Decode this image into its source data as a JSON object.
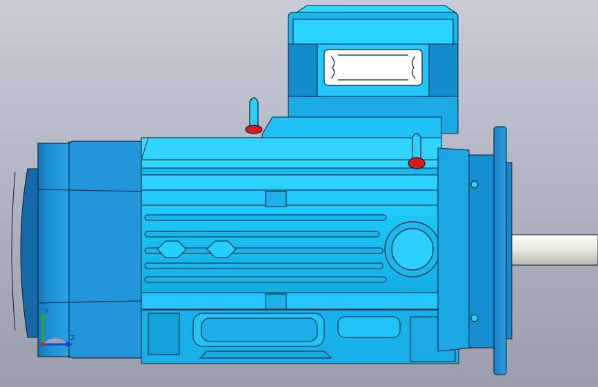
{
  "viewport": {
    "background_top": "#c9ccd6",
    "background_bottom": "#9a9eac"
  },
  "model": {
    "part_color": "#19b9f0",
    "part_color_light": "#22d2ff",
    "part_color_dark": "#0f86bf",
    "edge_color": "#0a1a33",
    "lifting_eye_color": "#d81b1b",
    "shaft_color": "#e9e9e4"
  },
  "triad": {
    "y_label": "Y",
    "z_label": "Z",
    "y_color": "#2ea82e",
    "z_color": "#1f3fd0",
    "x_color": "#d02020"
  }
}
